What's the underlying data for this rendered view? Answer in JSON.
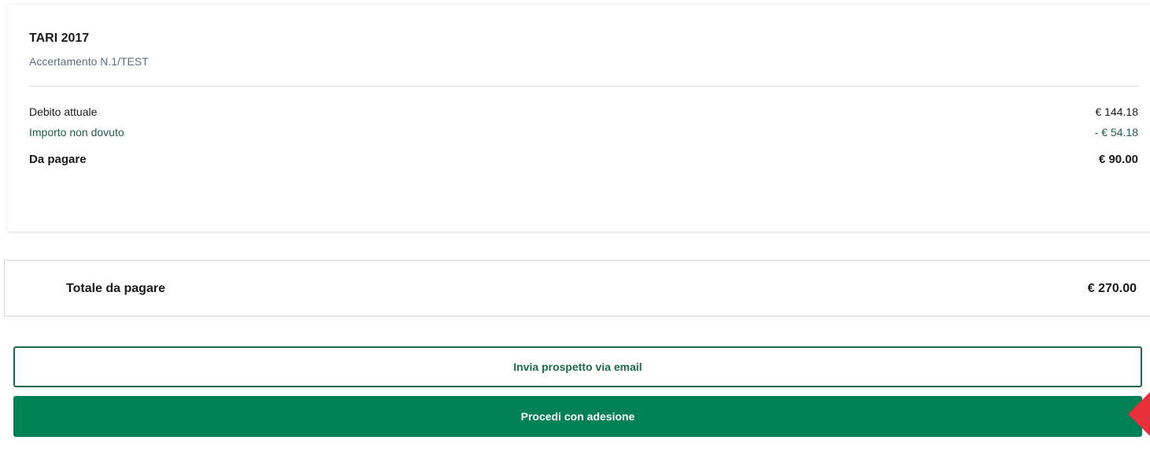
{
  "summary_card": {
    "title": "TARI 2017",
    "subtitle": "Accertamento N.1/TEST",
    "rows": [
      {
        "label": "Debito attuale",
        "value": "€ 144.18"
      },
      {
        "label": "Importo non dovuto",
        "value": "- € 54.18"
      },
      {
        "label": "Da pagare",
        "value": "€ 90.00"
      }
    ]
  },
  "total": {
    "label": "Totale da pagare",
    "value": "€ 270.00"
  },
  "actions": {
    "email_label": "Invia prospetto via email",
    "proceed_label": "Procedi con adesione"
  },
  "colors": {
    "primary_green": "#008055",
    "outline_green": "#1b6b47",
    "credit_text": "#1b5e3f",
    "pointer": "#e8303a"
  },
  "icons": {
    "pointer": "red-pointer-arrow-icon"
  }
}
